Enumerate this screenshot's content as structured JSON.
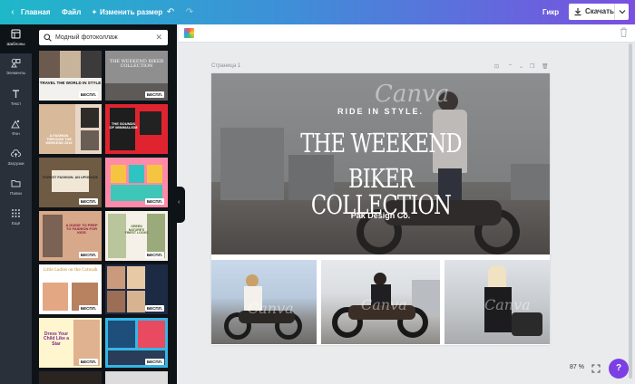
{
  "topbar": {
    "home": "Главная",
    "file": "Файл",
    "resize": "Изменить размер",
    "guest": "Гикр",
    "download": "Скачать"
  },
  "rail": [
    {
      "label": "Шаблоны"
    },
    {
      "label": "Элементы"
    },
    {
      "label": "Текст"
    },
    {
      "label": "Фон"
    },
    {
      "label": "Загрузки"
    },
    {
      "label": "Папки"
    },
    {
      "label": "Ещё"
    }
  ],
  "search": {
    "value": "Модный фотоколлаж"
  },
  "templates": [
    {
      "text": "TRAVEL THE WORLD IN STYLE",
      "badge": "БЕСПЛ."
    },
    {
      "text": "THE WEEKEND BIKER COLLECTION",
      "badge": "БЕСПЛ."
    },
    {
      "text": "A FASHION THROUGH THE WEEKEND 2019",
      "badge": ""
    },
    {
      "text": "THE SOUNDS OF MINIMALISM",
      "badge": ""
    },
    {
      "text": "FOREST FASHION: AN UPGRADE",
      "badge": "БЕСПЛ."
    },
    {
      "text": "",
      "badge": "БЕСПЛ."
    },
    {
      "text": "A GUIDE TO PREP TO FASHION FOR KIDS",
      "badge": "БЕСПЛ."
    },
    {
      "text": "GREEN NATURE'S FINEST LOOKS",
      "badge": "БЕСПЛ."
    },
    {
      "text": "Little Ladies on the Catwalk",
      "badge": "БЕСПЛ."
    },
    {
      "text": "",
      "badge": "БЕСПЛ."
    },
    {
      "text": "Dress Your Child Like a Star",
      "badge": "БЕСПЛ."
    },
    {
      "text": "",
      "badge": "БЕСПЛ."
    }
  ],
  "canvas": {
    "page_label": "Страница 1",
    "subtitle": "RIDE IN STYLE.",
    "title_line1": "THE WEEKEND",
    "title_line2": "BIKER COLLECTION",
    "brand": "Pak Design Co.",
    "watermark": "Canva"
  },
  "zoom": "87 %",
  "help": "?"
}
